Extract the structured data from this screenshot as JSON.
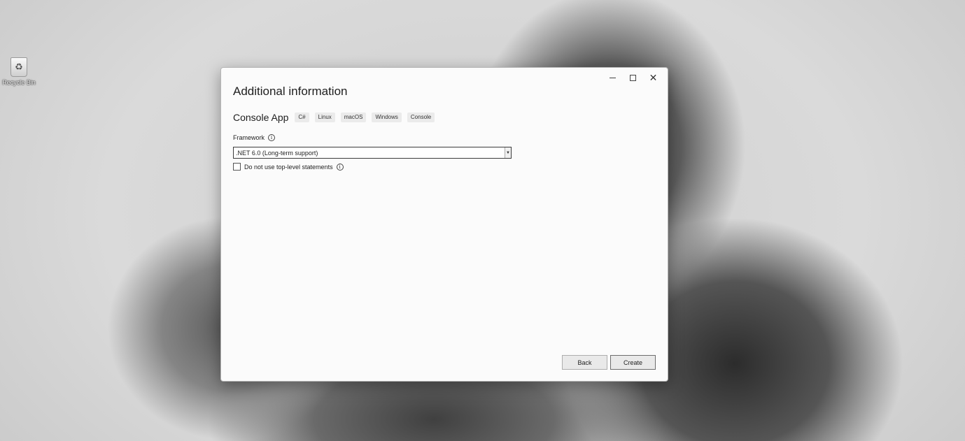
{
  "desktop": {
    "icons": [
      {
        "label": "Recycle Bin",
        "icon": "recycle-bin-icon"
      }
    ]
  },
  "window": {
    "controls": {
      "minimize": "minimize-icon",
      "maximize": "maximize-icon",
      "close": "close-icon"
    },
    "title": "Additional information",
    "project": {
      "name": "Console App",
      "tags": [
        "C#",
        "Linux",
        "macOS",
        "Windows",
        "Console"
      ]
    },
    "framework": {
      "label": "Framework",
      "selected": ".NET 6.0 (Long-term support)"
    },
    "top_level_statements": {
      "label": "Do not use top-level statements",
      "checked": false
    },
    "buttons": {
      "back": "Back",
      "create": "Create"
    }
  }
}
